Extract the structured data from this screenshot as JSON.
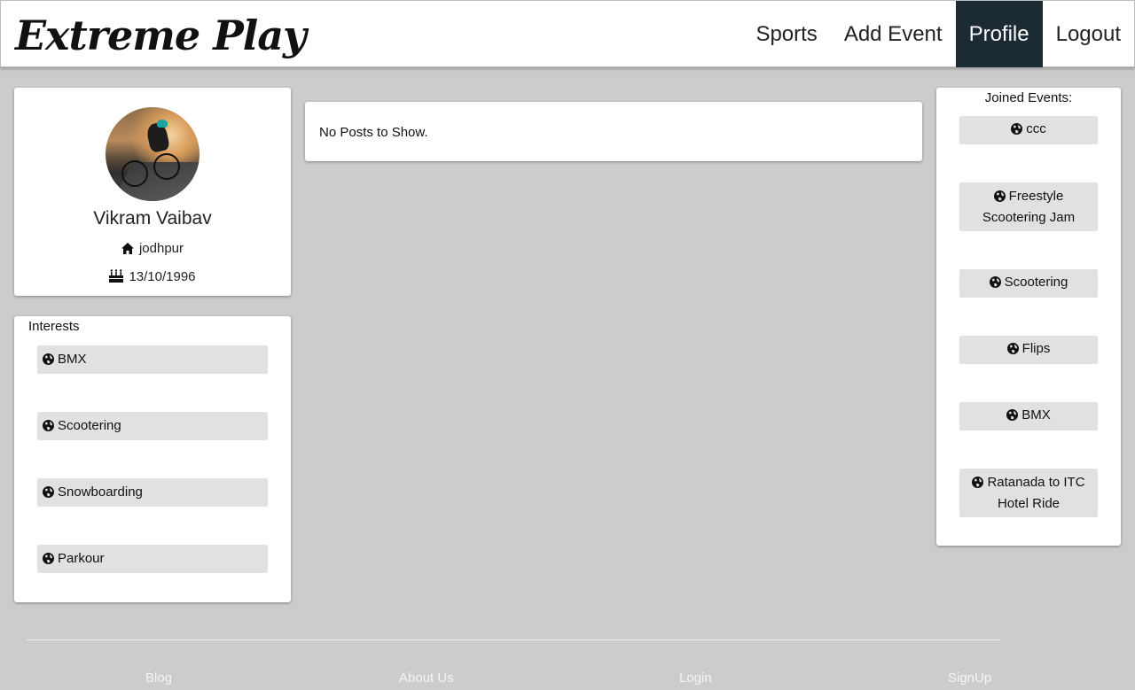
{
  "nav": {
    "brand": "Extreme Play",
    "links": [
      "Sports",
      "Add Event",
      "Profile",
      "Logout"
    ],
    "active": "Profile",
    "active_bg": "#1c2a33"
  },
  "profile": {
    "name": "Vikram Vaibav",
    "city": "jodhpur",
    "dob": "13/10/1996"
  },
  "interests": {
    "title": "Interests",
    "items": [
      "BMX",
      "Scootering",
      "Snowboarding",
      "Parkour"
    ]
  },
  "posts": {
    "empty_text": "No Posts to Show."
  },
  "joined_events": {
    "title": "Joined Events:",
    "items": [
      "ccc",
      "Freestyle Scootering Jam",
      "Scootering",
      "Flips",
      "BMX",
      "Ratanada to ITC Hotel Ride"
    ]
  },
  "footer": {
    "links": [
      "Blog",
      "About Us",
      "Login",
      "SignUp"
    ]
  },
  "icons": {
    "event_icon": "globe-icon",
    "home_icon": "home-icon",
    "dob_icon": "birthday-cake-icon"
  },
  "colors": {
    "page_bg": "#cccccc",
    "chip_bg": "#e1e1e1",
    "card_bg": "#ffffff"
  }
}
